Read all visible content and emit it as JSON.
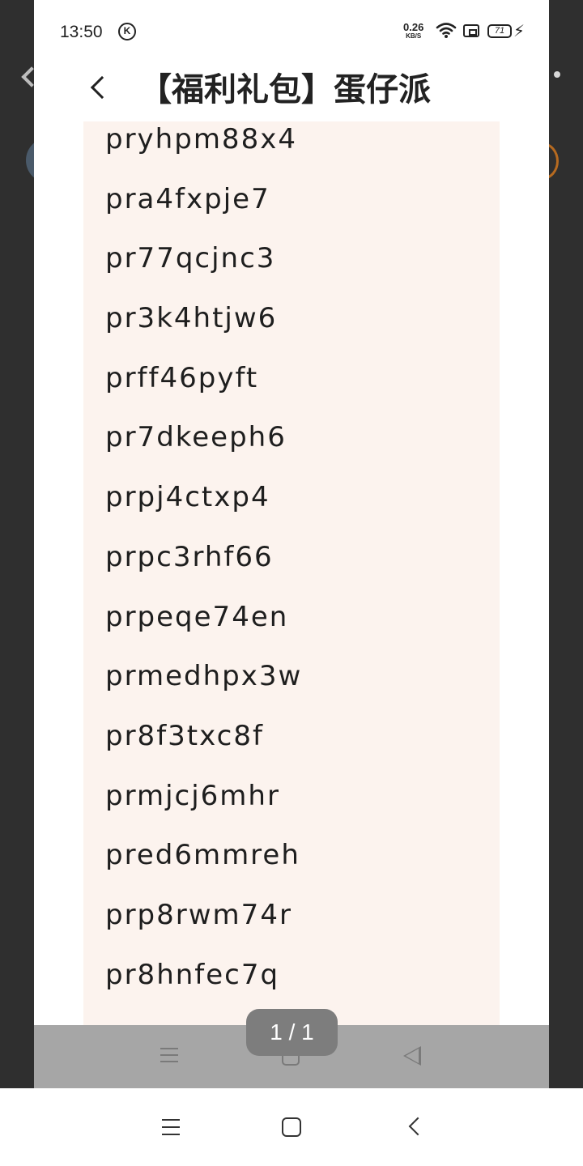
{
  "status_bar": {
    "time": "13:50",
    "k_badge": "K",
    "net_speed": "0.26",
    "net_unit": "KB/S",
    "battery": "71"
  },
  "header": {
    "title": "【福利礼包】蛋仔派"
  },
  "codes": [
    "pryhpm88x4",
    "pra4fxpje7",
    "pr77qcjnc3",
    "pr3k4htjw6",
    "prff46pyft",
    "pr7dkeeph6",
    "prpj4ctxp4",
    "prpc3rhf66",
    "prpeqe74en",
    "prmedhpx3w",
    "pr8f3txc8f",
    "prmjcj6mhr",
    "pred6mmreh",
    "prp8rwm74r",
    "pr8hnfec7q"
  ],
  "pager": {
    "text": "1 / 1"
  },
  "icons": {
    "back": "back-chevron-icon",
    "wifi": "wifi-icon",
    "sim": "sim-icon",
    "battery": "battery-icon",
    "charging": "charging-bolt-icon",
    "nav_menu": "menu-icon",
    "nav_home": "home-icon",
    "nav_back": "back-icon"
  },
  "colors": {
    "panel_background": "#fcf3ee",
    "backdrop": "#2f2f2f",
    "pager_pill": "#7d7d7d"
  }
}
